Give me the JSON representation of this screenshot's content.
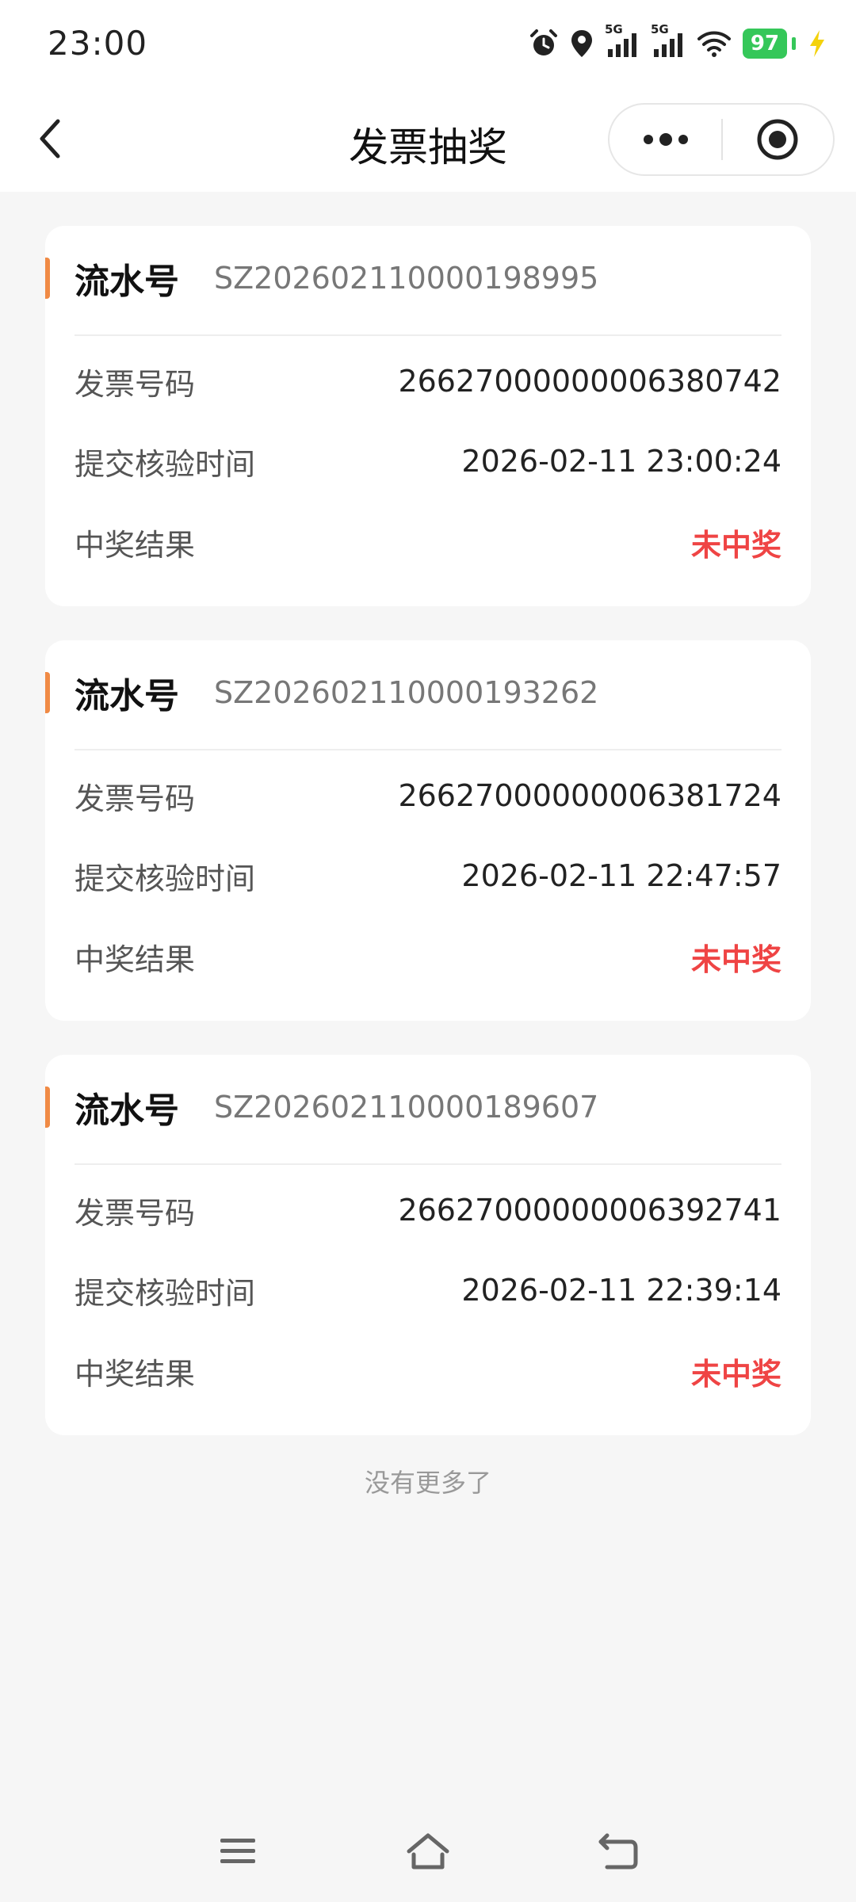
{
  "status_bar": {
    "time": "23:00",
    "network_1": "5G",
    "network_2": "5G",
    "battery_level": "97"
  },
  "navbar": {
    "title": "发票抽奖"
  },
  "records": [
    {
      "serial_label": "流水号",
      "serial_value": "SZ202602110000198995",
      "invoice_label": "发票号码",
      "invoice_value": "26627000000006380742",
      "time_label": "提交核验时间",
      "time_value": "2026-02-11 23:00:24",
      "result_label": "中奖结果",
      "result_value": "未中奖"
    },
    {
      "serial_label": "流水号",
      "serial_value": "SZ202602110000193262",
      "invoice_label": "发票号码",
      "invoice_value": "26627000000006381724",
      "time_label": "提交核验时间",
      "time_value": "2026-02-11 22:47:57",
      "result_label": "中奖结果",
      "result_value": "未中奖"
    },
    {
      "serial_label": "流水号",
      "serial_value": "SZ202602110000189607",
      "invoice_label": "发票号码",
      "invoice_value": "26627000000006392741",
      "time_label": "提交核验时间",
      "time_value": "2026-02-11 22:39:14",
      "result_label": "中奖结果",
      "result_value": "未中奖"
    }
  ],
  "list_end_text": "没有更多了",
  "colors": {
    "accent": "#f08a45",
    "result_text": "#ef4444",
    "battery": "#35c759",
    "background": "#f6f6f6"
  },
  "icons": {
    "back": "chevron-left-icon",
    "more": "more-dots-icon",
    "close": "target-circle-icon",
    "alarm": "alarm-icon",
    "location": "location-pin-icon",
    "signal": "signal-bars-icon",
    "wifi": "wifi-icon",
    "charging": "charging-bolt-icon",
    "nav_menu": "menu-icon",
    "nav_home": "home-icon",
    "nav_back": "back-arrow-icon"
  }
}
